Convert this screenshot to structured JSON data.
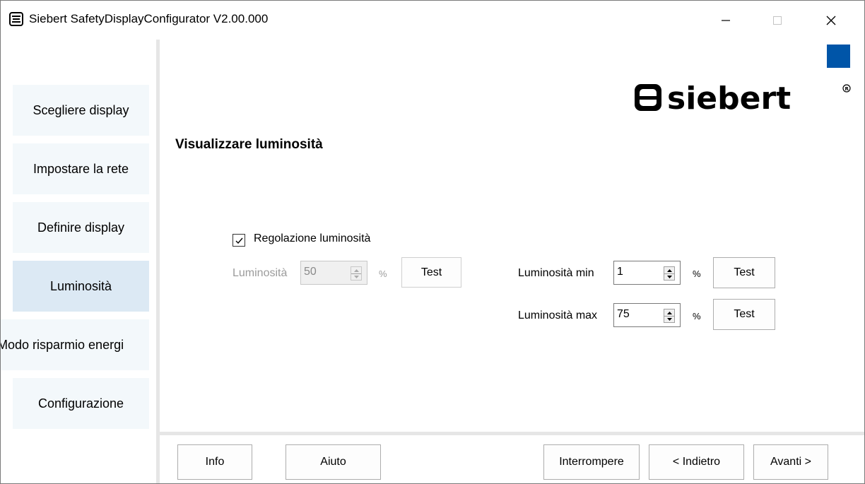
{
  "window": {
    "title": "Siebert SafetyDisplayConfigurator V2.00.000"
  },
  "sidebar": {
    "items": [
      {
        "label": "Scegliere display"
      },
      {
        "label": "Impostare la rete"
      },
      {
        "label": "Definire display"
      },
      {
        "label": "Luminosità",
        "active": true
      },
      {
        "label": "Modo risparmio energi"
      },
      {
        "label": "Configurazione"
      }
    ]
  },
  "header": {
    "brand_logo_text": "siebert",
    "brand_color": "#0055a8"
  },
  "main": {
    "heading": "Visualizzare luminosità",
    "regulation_checkbox": {
      "label": "Regolazione luminosità",
      "checked": true
    },
    "brightness": {
      "label": "Luminosità",
      "value": "50",
      "unit": "%",
      "test_label": "Test",
      "enabled": false
    },
    "brightness_min": {
      "label": "Luminosità min",
      "value": "1",
      "unit": "%",
      "test_label": "Test"
    },
    "brightness_max": {
      "label": "Luminosità max",
      "value": "75",
      "unit": "%",
      "test_label": "Test"
    }
  },
  "footer": {
    "info_label": "Info",
    "help_label": "Aiuto",
    "cancel_label": "Interrompere",
    "back_label": "< Indietro",
    "next_label": "Avanti >"
  }
}
